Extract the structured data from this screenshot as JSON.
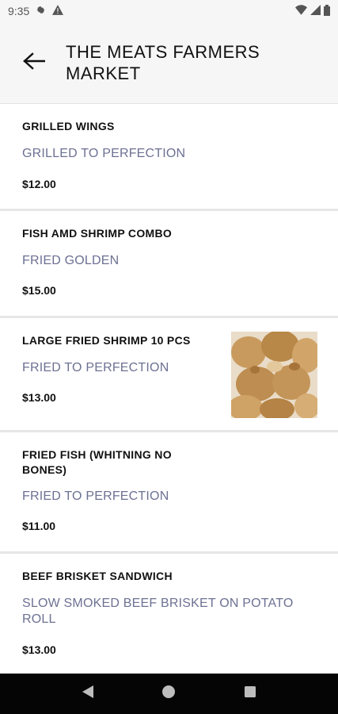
{
  "status_bar": {
    "time": "9:35",
    "icons": [
      "gear-icon",
      "warning-icon",
      "wifi-icon",
      "signal-icon",
      "battery-icon"
    ]
  },
  "header": {
    "title": "THE MEATS FARMERS MARKET",
    "back_icon": "arrow-left-icon"
  },
  "menu": {
    "items": [
      {
        "name": "GRILLED WINGS",
        "description": "GRILLED TO PERFECTION",
        "price": "$12.00"
      },
      {
        "name": "FISH AMD SHRIMP COMBO",
        "description": "FRIED GOLDEN",
        "price": "$15.00"
      },
      {
        "name": "LARGE FRIED SHRIMP 10 PCS",
        "description": "FRIED TO PERFECTION",
        "price": "$13.00",
        "has_image": true
      },
      {
        "name": "FRIED FISH (WHITNING NO BONES)",
        "description": "FRIED TO PERFECTION",
        "price": "$11.00"
      },
      {
        "name": "BEEF BRISKET SANDWICH",
        "description": "SLOW SMOKED BEEF BRISKET ON POTATO ROLL",
        "price": "$13.00"
      }
    ]
  },
  "nav_bar": {
    "icons": [
      "back-triangle-icon",
      "home-circle-icon",
      "recents-square-icon"
    ]
  },
  "colors": {
    "description_text": "#6c7193",
    "header_bg": "#f6f6f6",
    "divider": "#e6e6e6",
    "nav_bg": "#050505"
  }
}
